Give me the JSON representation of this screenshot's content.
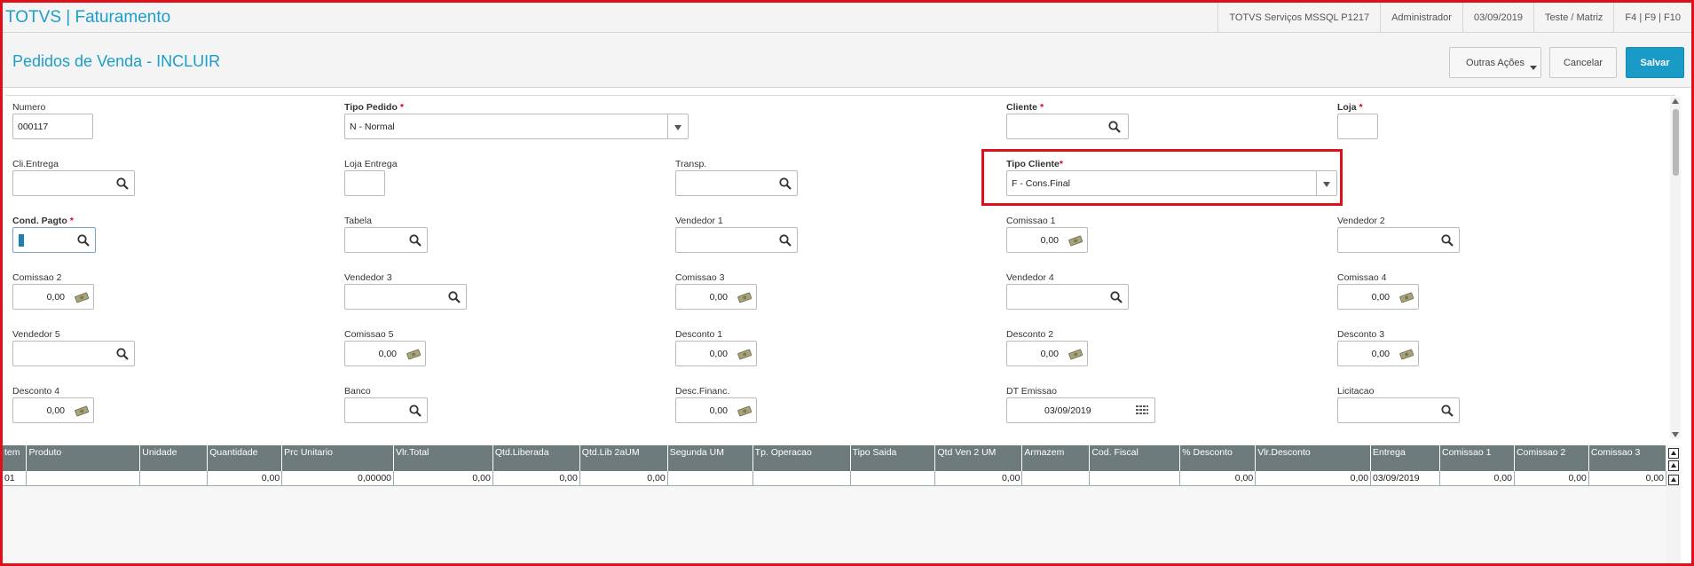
{
  "app": {
    "title": "TOTVS | Faturamento",
    "server": "TOTVS Serviços MSSQL P1217",
    "user": "Administrador",
    "date": "03/09/2019",
    "company": "Teste / Matriz",
    "shortcuts": "F4 | F9 | F10"
  },
  "page": {
    "title": "Pedidos de Venda - INCLUIR",
    "outras_acoes": "Outras Ações",
    "cancelar": "Cancelar",
    "salvar": "Salvar"
  },
  "form": {
    "numero": {
      "label": "Numero",
      "value": "000117"
    },
    "tipo_pedido": {
      "label": "Tipo Pedido",
      "value": "N - Normal"
    },
    "cliente": {
      "label": "Cliente",
      "value": ""
    },
    "loja": {
      "label": "Loja",
      "value": ""
    },
    "cli_entrega": {
      "label": "Cli.Entrega",
      "value": ""
    },
    "loja_entrega": {
      "label": "Loja Entrega",
      "value": ""
    },
    "transp": {
      "label": "Transp.",
      "value": ""
    },
    "tipo_cliente": {
      "label": "Tipo Cliente",
      "value": "F - Cons.Final"
    },
    "cond_pagto": {
      "label": "Cond. Pagto",
      "value": ""
    },
    "tabela": {
      "label": "Tabela",
      "value": ""
    },
    "vendedor1": {
      "label": "Vendedor 1",
      "value": ""
    },
    "comissao1": {
      "label": "Comissao 1",
      "value": "0,00"
    },
    "vendedor2": {
      "label": "Vendedor 2",
      "value": ""
    },
    "comissao2": {
      "label": "Comissao 2",
      "value": "0,00"
    },
    "vendedor3": {
      "label": "Vendedor 3",
      "value": ""
    },
    "comissao3": {
      "label": "Comissao 3",
      "value": "0,00"
    },
    "vendedor4": {
      "label": "Vendedor 4",
      "value": ""
    },
    "comissao4": {
      "label": "Comissao 4",
      "value": "0,00"
    },
    "vendedor5": {
      "label": "Vendedor 5",
      "value": ""
    },
    "comissao5": {
      "label": "Comissao 5",
      "value": "0,00"
    },
    "desconto1": {
      "label": "Desconto 1",
      "value": "0,00"
    },
    "desconto2": {
      "label": "Desconto 2",
      "value": "0,00"
    },
    "desconto3": {
      "label": "Desconto 3",
      "value": "0,00"
    },
    "desconto4": {
      "label": "Desconto 4",
      "value": "0,00"
    },
    "banco": {
      "label": "Banco",
      "value": ""
    },
    "desc_financ": {
      "label": "Desc.Financ.",
      "value": "0,00"
    },
    "dt_emissao": {
      "label": "DT Emissao",
      "value": "03/09/2019"
    },
    "licitacao": {
      "label": "Licitacao",
      "value": ""
    }
  },
  "grid": {
    "headers": [
      "tem",
      "Produto",
      "Unidade",
      "Quantidade",
      "Prc Unitario",
      "Vlr.Total",
      "Qtd.Liberada",
      "Qtd.Lib 2aUM",
      "Segunda UM",
      "Tp. Operacao",
      "Tipo Saida",
      "Qtd Ven 2 UM",
      "Armazem",
      "Cod. Fiscal",
      "% Desconto",
      "Vlr.Desconto",
      "Entrega",
      "Comissao 1",
      "Comissao 2",
      "Comissao 3"
    ],
    "row": [
      "01",
      "",
      "",
      "0,00",
      "0,00000",
      "0,00",
      "0,00",
      "0,00",
      "",
      "",
      "",
      "0,00",
      "",
      "",
      "0,00",
      "0,00",
      "03/09/2019",
      "0,00",
      "0,00",
      "0,00"
    ]
  },
  "icons": {
    "lookup": "search-icon",
    "money": "money-icon",
    "calendar": "calendar-icon"
  },
  "colors": {
    "accent": "#1aa0c8",
    "highlight": "#e0101a",
    "grid_header": "#6e7b7d",
    "required": "#d9001b"
  }
}
